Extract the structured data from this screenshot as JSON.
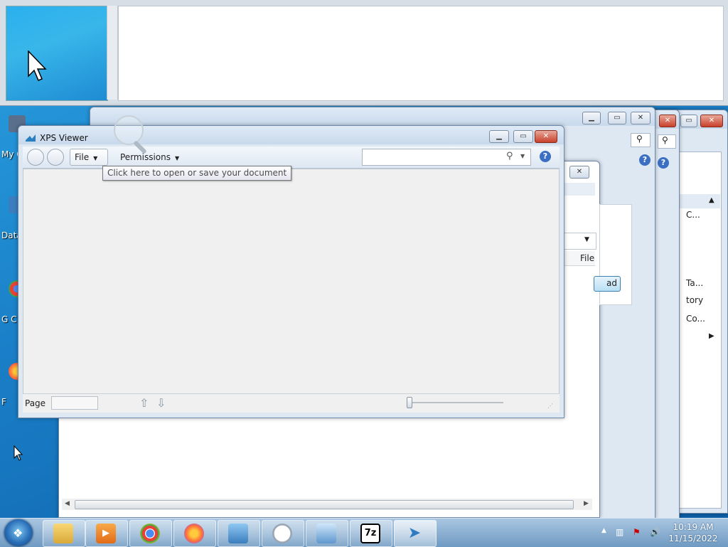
{
  "desktop": {
    "icons": [
      {
        "label": "My C"
      },
      {
        "label": "Data"
      },
      {
        "label": "G C"
      },
      {
        "label": "F"
      }
    ]
  },
  "background_windows": {
    "win_a": {
      "right_panel_items": [
        "C...",
        "Ta...",
        "tory",
        "Co..."
      ]
    },
    "win_b": {
      "column_header": "File",
      "button_label": "ad"
    }
  },
  "xps_viewer": {
    "title": "XPS Viewer",
    "file_label": "File",
    "permissions_label": "Permissions",
    "search_placeholder": "",
    "help_glyph": "?",
    "page_label": "Page",
    "page_value": ""
  },
  "tooltip": {
    "text": "Click here to open or save your document"
  },
  "taskbar": {
    "apps": [
      {
        "name": "windows-explorer"
      },
      {
        "name": "media-player"
      },
      {
        "name": "chrome"
      },
      {
        "name": "firefox"
      },
      {
        "name": "control-panel"
      },
      {
        "name": "clock-app"
      },
      {
        "name": "magnifier-app"
      },
      {
        "name": "7zip",
        "glyph": "7z"
      },
      {
        "name": "paper-plane-app"
      }
    ],
    "clock": {
      "time": "10:19 AM",
      "date": "11/15/2022"
    }
  },
  "colors": {
    "accent": "#1c8fd0",
    "close_red": "#c8402a",
    "help_blue": "#3a6fc4"
  }
}
